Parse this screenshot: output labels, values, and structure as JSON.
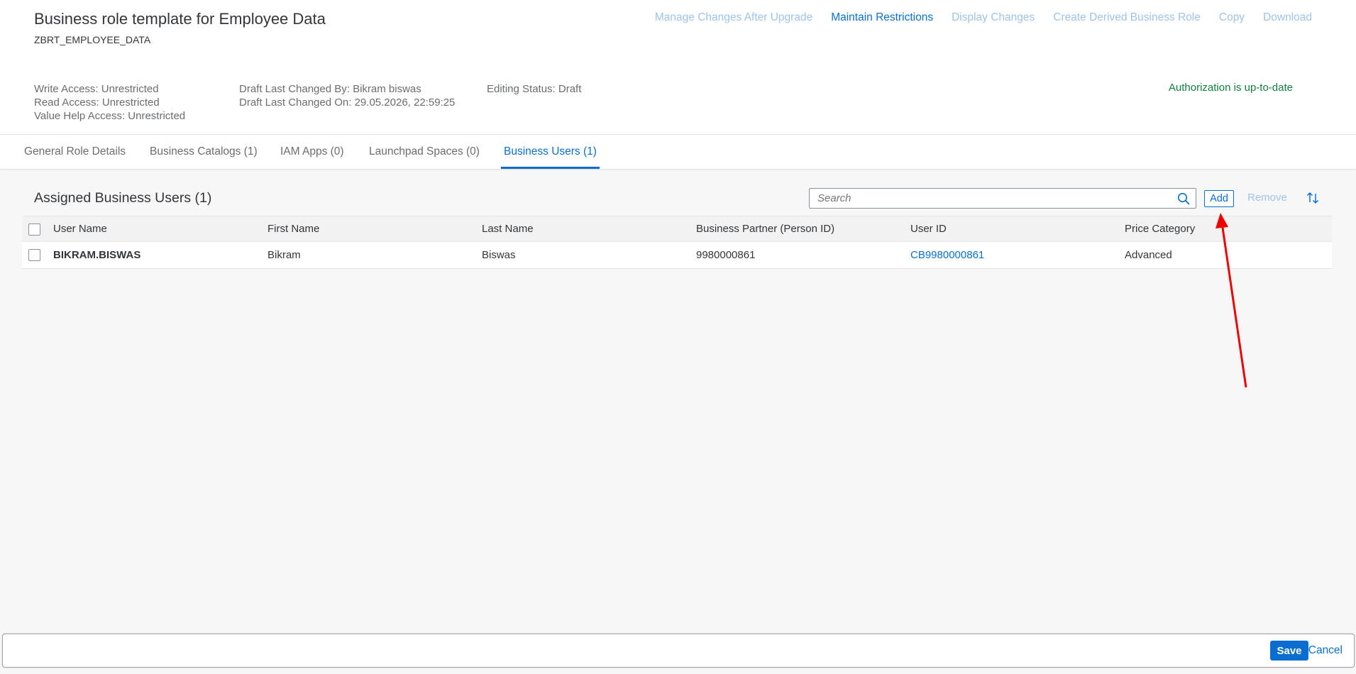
{
  "header": {
    "title": "Business role template for Employee Data",
    "subtitle": "ZBRT_EMPLOYEE_DATA",
    "actions": [
      {
        "label": "Manage Changes After Upgrade",
        "enabled": false
      },
      {
        "label": "Maintain Restrictions",
        "enabled": true
      },
      {
        "label": "Display Changes",
        "enabled": false
      },
      {
        "label": "Create Derived Business Role",
        "enabled": false
      },
      {
        "label": "Copy",
        "enabled": false
      },
      {
        "label": "Download",
        "enabled": false
      }
    ],
    "meta": {
      "write_access": "Write Access: Unrestricted",
      "read_access": "Read Access: Unrestricted",
      "value_help_access": "Value Help Access: Unrestricted",
      "draft_changed_by": "Draft Last Changed By: Bikram biswas",
      "draft_changed_on": "Draft Last Changed On: 29.05.2026, 22:59:25",
      "editing_status": "Editing Status: Draft"
    },
    "authorization_status": "Authorization is up-to-date"
  },
  "tabs": [
    {
      "label": "General Role Details",
      "active": false
    },
    {
      "label": "Business Catalogs (1)",
      "active": false
    },
    {
      "label": "IAM Apps (0)",
      "active": false
    },
    {
      "label": "Launchpad Spaces (0)",
      "active": false
    },
    {
      "label": "Business Users (1)",
      "active": true
    }
  ],
  "section": {
    "title": "Assigned Business Users (1)",
    "search_placeholder": "Search",
    "add_label": "Add",
    "remove_label": "Remove"
  },
  "table": {
    "columns": [
      "User Name",
      "First Name",
      "Last Name",
      "Business Partner (Person ID)",
      "User ID",
      "Price Category"
    ],
    "rows": [
      [
        "BIKRAM.BISWAS",
        "Bikram",
        "Biswas",
        "9980000861",
        "CB9980000861",
        "Advanced"
      ]
    ]
  },
  "footer": {
    "save_label": "Save",
    "cancel_label": "Cancel"
  },
  "colors": {
    "accent": "#0a6ed1",
    "disabled_link": "#9ec3e8",
    "success": "#107e3e",
    "annotation_arrow": "#ee0000"
  }
}
